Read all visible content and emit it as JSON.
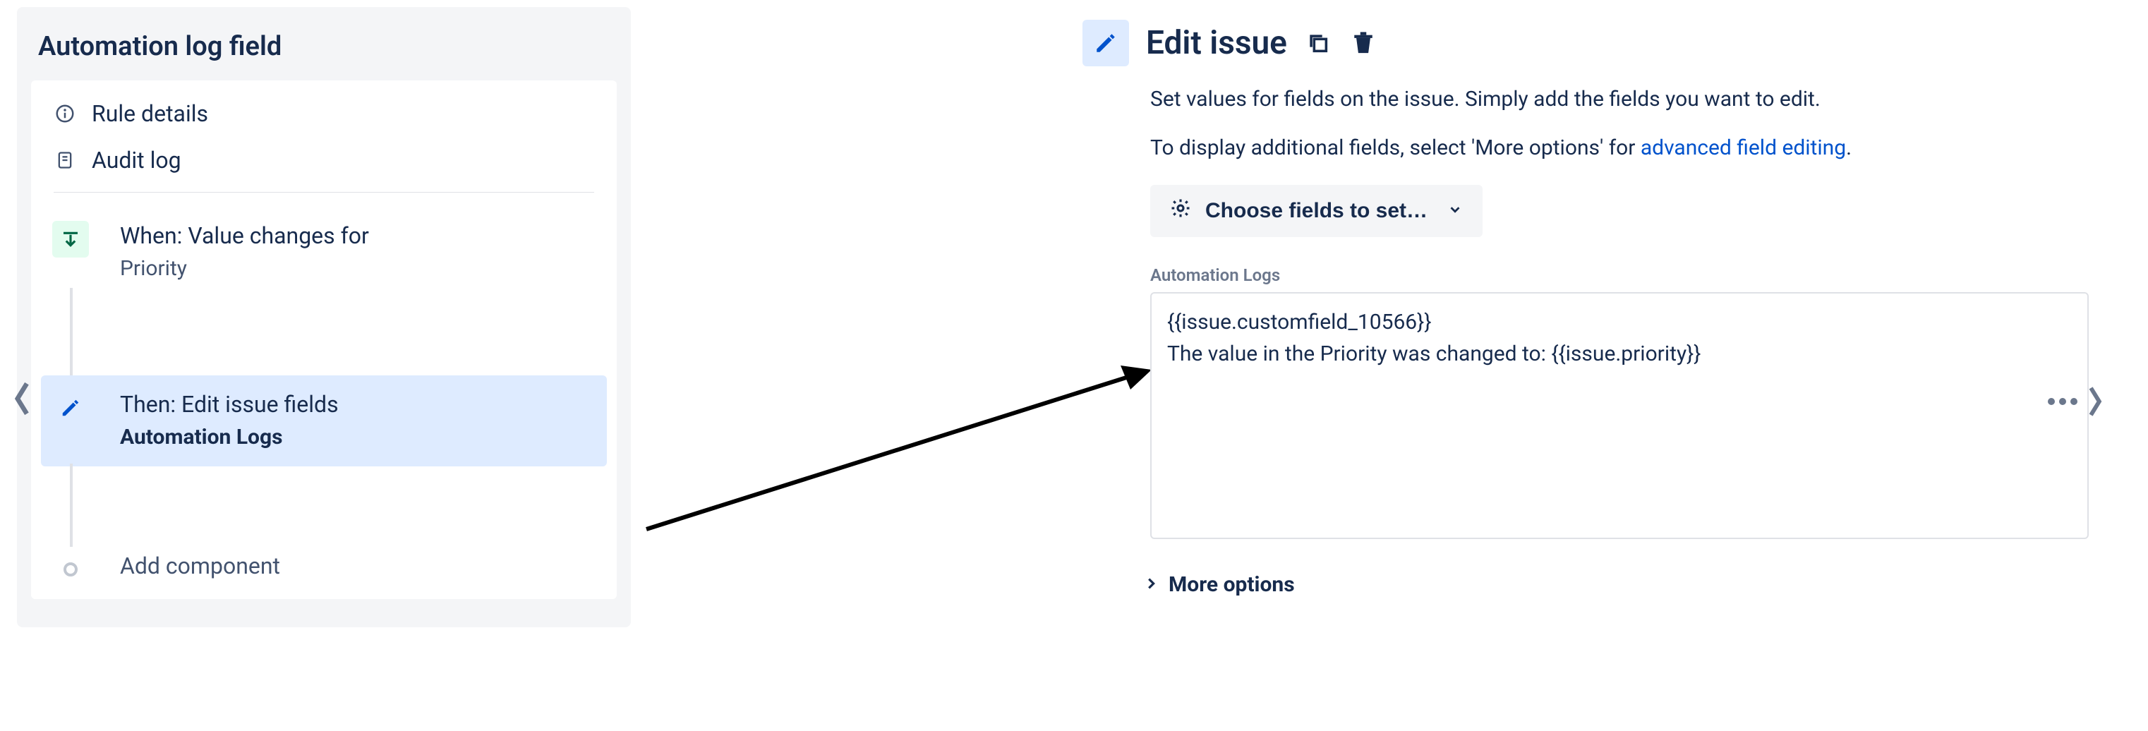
{
  "sidebar": {
    "title": "Automation log field",
    "nav": {
      "rule_details": "Rule details",
      "audit_log": "Audit log"
    },
    "trigger": {
      "title": "When: Value changes for",
      "sub": "Priority"
    },
    "action": {
      "title": "Then: Edit issue fields",
      "sub": "Automation Logs"
    },
    "add": "Add component"
  },
  "details": {
    "heading": "Edit issue",
    "desc1": "Set values for fields on the issue. Simply add the fields you want to edit.",
    "desc2_pre": "To display additional fields, select 'More options' for ",
    "desc2_link": "advanced field editing",
    "desc2_post": ".",
    "choose_label": "Choose fields to set…",
    "field_label": "Automation Logs",
    "field_value": "{{issue.customfield_10566}}\nThe value in the Priority was changed to: {{issue.priority}}",
    "more_options": "More options"
  }
}
